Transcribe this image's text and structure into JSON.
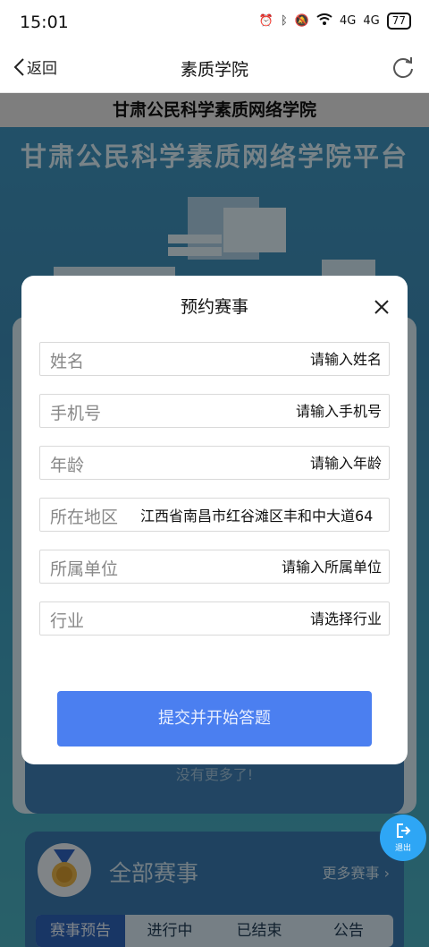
{
  "status_bar": {
    "time": "15:01",
    "battery": "77",
    "signal1": "4G",
    "signal2": "4G"
  },
  "nav": {
    "back_label": "返回",
    "title": "素质学院"
  },
  "page": {
    "org_title": "甘肃公民科学素质网络学院",
    "banner_title": "甘肃公民科学素质网络学院平台",
    "no_more": "没有更多了!",
    "all_events_title": "全部赛事",
    "more_events": "更多赛事 ›",
    "tabs": [
      "赛事预告",
      "进行中",
      "已结束",
      "公告"
    ]
  },
  "exit_button": {
    "label": "退出"
  },
  "modal": {
    "title": "预约赛事",
    "fields": [
      {
        "label": "姓名",
        "placeholder": "请输入姓名",
        "value": ""
      },
      {
        "label": "手机号",
        "placeholder": "请输入手机号",
        "value": ""
      },
      {
        "label": "年龄",
        "placeholder": "请输入年龄",
        "value": ""
      },
      {
        "label": "所在地区",
        "placeholder": "",
        "value": "江西省南昌市红谷滩区丰和中大道64"
      },
      {
        "label": "所属单位",
        "placeholder": "请输入所属单位",
        "value": ""
      },
      {
        "label": "行业",
        "placeholder": "请选择行业",
        "value": ""
      }
    ],
    "submit_label": "提交并开始答题"
  },
  "colors": {
    "primary": "#4b7ff0",
    "exit": "#2ea6f5",
    "tab_active": "#2c63b8"
  }
}
